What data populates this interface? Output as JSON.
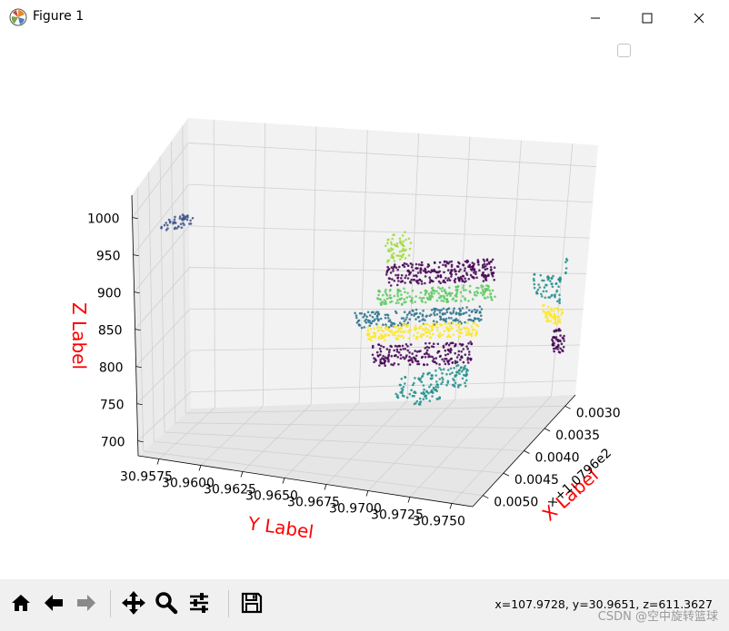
{
  "window": {
    "title": "Figure 1",
    "minimize_icon": "minimize-icon",
    "maximize_icon": "maximize-icon",
    "close_icon": "close-icon"
  },
  "toolbar": {
    "buttons": [
      {
        "name": "home-button",
        "icon": "home-icon"
      },
      {
        "name": "back-button",
        "icon": "arrow-left-icon"
      },
      {
        "name": "forward-button",
        "icon": "arrow-right-icon"
      },
      {
        "name": "pan-button",
        "icon": "move-icon"
      },
      {
        "name": "zoom-button",
        "icon": "magnifier-icon"
      },
      {
        "name": "configure-subplots-button",
        "icon": "sliders-icon"
      },
      {
        "name": "save-button",
        "icon": "floppy-disk-icon"
      }
    ],
    "coordinates": "x=107.9728, y=30.9651, z=611.3627"
  },
  "watermark": "CSDN @空中旋转篮球",
  "colors": {
    "label": "#ff0000",
    "clusters": [
      "#440154",
      "#3b528b",
      "#21918c",
      "#5ec962",
      "#fde725",
      "#2c728e",
      "#a0da39"
    ]
  },
  "chart_data": {
    "type": "scatter3d",
    "xlabel": "X Label",
    "ylabel": "Y Label",
    "zlabel": "Z Label",
    "x_offset_text": "+1.0796e2",
    "x_offset_prefix": "×",
    "x_ticks": [
      "0.0030",
      "0.0035",
      "0.0040",
      "0.0045",
      "0.0050"
    ],
    "y_ticks": [
      "30.9575",
      "30.9600",
      "30.9625",
      "30.9650",
      "30.9675",
      "30.9700",
      "30.9725",
      "30.9750"
    ],
    "z_ticks": [
      "700",
      "750",
      "800",
      "850",
      "900",
      "950",
      "1000"
    ],
    "zlim": [
      680,
      1030
    ],
    "grid": true,
    "legend": "top-right (empty)",
    "clusters": [
      {
        "color": "#3b528b",
        "region": "upper-left small group",
        "z_range": [
          980,
          1010
        ]
      },
      {
        "color": "#a0da39",
        "region": "center top",
        "z_range": [
          940,
          985
        ]
      },
      {
        "color": "#440154",
        "region": "center upper band",
        "z_range": [
          900,
          950
        ]
      },
      {
        "color": "#5ec962",
        "region": "center band",
        "z_range": [
          880,
          915
        ]
      },
      {
        "color": "#2c728e",
        "region": "center middle band",
        "z_range": [
          855,
          890
        ]
      },
      {
        "color": "#fde725",
        "region": "center yellow band",
        "z_range": [
          830,
          865
        ]
      },
      {
        "color": "#440154",
        "region": "center lower band",
        "z_range": [
          790,
          835
        ]
      },
      {
        "color": "#21918c",
        "region": "center bottom tail",
        "z_range": [
          730,
          795
        ]
      },
      {
        "color": "#21918c",
        "region": "right strip upper",
        "z_range": [
          890,
          935
        ]
      },
      {
        "color": "#fde725",
        "region": "right strip middle",
        "z_range": [
          855,
          885
        ]
      },
      {
        "color": "#440154",
        "region": "right strip lower",
        "z_range": [
          815,
          855
        ]
      }
    ]
  }
}
